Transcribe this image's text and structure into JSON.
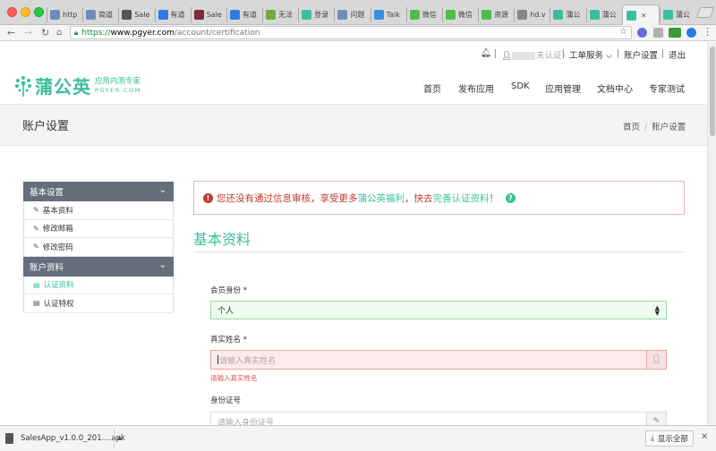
{
  "browser": {
    "tabs": [
      {
        "label": "http",
        "icon": "doc-icon",
        "color": "#6c8ebf"
      },
      {
        "label": "简道",
        "icon": "doc-icon",
        "color": "#6c8ebf"
      },
      {
        "label": "Sale",
        "icon": "book-icon",
        "color": "#555555"
      },
      {
        "label": "有道",
        "icon": "compass-icon",
        "color": "#2d7be5"
      },
      {
        "label": "Sale",
        "icon": "app-icon",
        "color": "#7a2b3e"
      },
      {
        "label": "有道",
        "icon": "compass-icon",
        "color": "#2d7be5"
      },
      {
        "label": "无法",
        "icon": "frog-icon",
        "color": "#6fae3d"
      },
      {
        "label": "登录",
        "icon": "spiral-icon",
        "color": "#3abf9c"
      },
      {
        "label": "问题",
        "icon": "doc-icon",
        "color": "#6c8ebf"
      },
      {
        "label": "Talk",
        "icon": "talk-icon",
        "color": "#3a8fe0"
      },
      {
        "label": "微信",
        "icon": "wechat-icon",
        "color": "#4bbf4b"
      },
      {
        "label": "微信",
        "icon": "wechat-icon",
        "color": "#4bbf4b"
      },
      {
        "label": "资源",
        "icon": "wechat-icon",
        "color": "#4bbf4b"
      },
      {
        "label": "hd.v",
        "icon": "page-icon",
        "color": "#888888"
      },
      {
        "label": "蒲公",
        "icon": "pgyer-icon",
        "color": "#3abf9c"
      },
      {
        "label": "蒲公",
        "icon": "pgyer-icon",
        "color": "#3abf9c"
      },
      {
        "label": "",
        "icon": "pgyer-icon",
        "color": "#3abf9c",
        "active": true
      },
      {
        "label": "蒲公",
        "icon": "pgyer-icon",
        "color": "#3abf9c"
      }
    ],
    "url_secure": "https://",
    "url_host": "www.pgyer.com",
    "url_path": "/account/certification"
  },
  "topnav": {
    "status_suffix": "未认证)",
    "workorder": "工单服务",
    "account_settings": "账户设置",
    "logout": "退出"
  },
  "logo": {
    "name": "蒲公英",
    "tagline": "应用内测专家",
    "domain": "PGYER.COM"
  },
  "mainnav": [
    "首页",
    "发布应用",
    "SDK",
    "应用管理",
    "文档中心",
    "专家测试"
  ],
  "banner": {
    "title": "账户设置",
    "crumb_home": "首页",
    "crumb_current": "账户设置"
  },
  "sidebar": {
    "group1": "基本设置",
    "group1_items": [
      "基本资料",
      "修改邮箱",
      "修改密码"
    ],
    "group2": "账户资料",
    "group2_items": [
      "认证资料",
      "认证特权"
    ]
  },
  "alert": {
    "pre": "您还没有通过信息审核，享受更多",
    "brand": "蒲公英福利",
    "mid": "，快去",
    "link": "完善认证资料",
    "post": "！"
  },
  "form": {
    "section_title": "基本资料",
    "member_label": "会员身份 *",
    "member_value": "个人",
    "realname_label": "真实姓名 *",
    "realname_placeholder": "请输入真实姓名",
    "realname_error": "请输入真实姓名",
    "idcard_label": "身份证号",
    "idcard_placeholder": "请输入身份证号"
  },
  "downloads": {
    "file": "SalesApp_v1.0.0_201....apk",
    "show_all": "显示全部"
  },
  "colors": {
    "brand": "#3abf9c",
    "sidebar_head": "#646e7d",
    "alert_text": "#c0392b"
  }
}
